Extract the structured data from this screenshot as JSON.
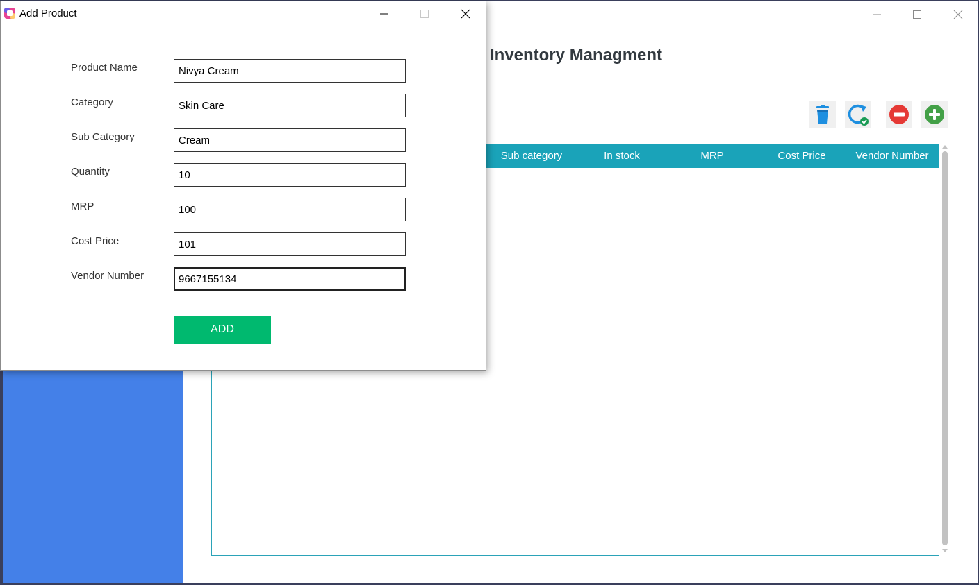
{
  "main_window": {
    "title": "Inventory Managment",
    "controls": {
      "minimize": "—",
      "maximize": "☐",
      "close": "✕"
    }
  },
  "toolbar": {
    "items": [
      {
        "name": "delete",
        "icon": "trash-icon",
        "color": "#1e8fe0"
      },
      {
        "name": "refresh",
        "icon": "refresh-check-icon",
        "color": "#1e8fe0"
      },
      {
        "name": "remove",
        "icon": "minus-circle-icon",
        "color": "#e53935"
      },
      {
        "name": "add",
        "icon": "plus-circle-icon",
        "color": "#43a047"
      }
    ]
  },
  "grid": {
    "columns": [
      "Sub category",
      "In stock",
      "MRP",
      "Cost Price",
      "Vendor Number"
    ],
    "rows": []
  },
  "dialog": {
    "title": "Add Product",
    "controls": {
      "minimize": "—",
      "maximize": "☐",
      "close": "✕"
    },
    "fields": [
      {
        "label": "Product Name",
        "value": "Nivya Cream"
      },
      {
        "label": "Category",
        "value": "Skin Care"
      },
      {
        "label": "Sub Category",
        "value": "Cream"
      },
      {
        "label": "Quantity",
        "value": "10"
      },
      {
        "label": "MRP",
        "value": "100"
      },
      {
        "label": "Cost Price",
        "value": "101"
      },
      {
        "label": "Vendor Number",
        "value": "9667155134"
      }
    ],
    "submit_label": "ADD"
  },
  "colors": {
    "sidebar": "#4480e8",
    "grid_header": "#1aa3b9",
    "add_button": "#00b96f"
  }
}
